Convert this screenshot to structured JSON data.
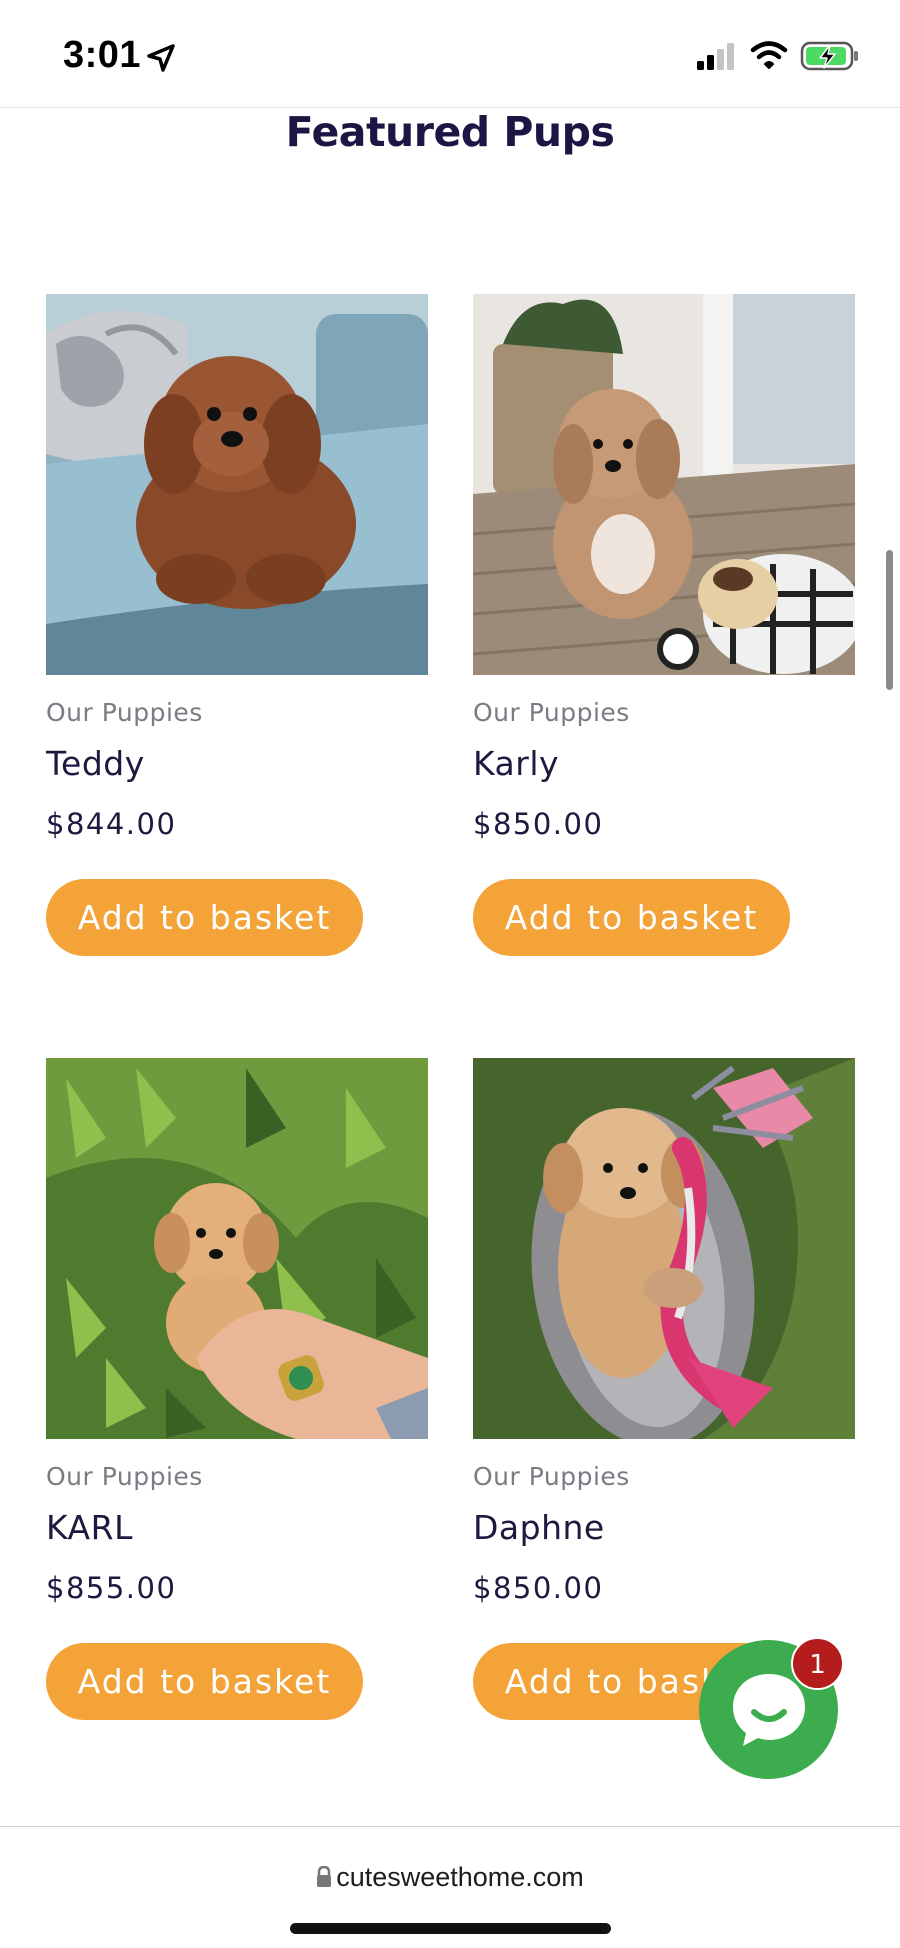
{
  "status_bar": {
    "time": "3:01",
    "battery_color": "#4cd964"
  },
  "section": {
    "title": "Featured Pups"
  },
  "products": [
    {
      "category": "Our Puppies",
      "name": "Teddy",
      "price": "$844.00",
      "button_label": "Add to basket"
    },
    {
      "category": "Our Puppies",
      "name": "Karly",
      "price": "$850.00",
      "button_label": "Add to basket"
    },
    {
      "category": "Our Puppies",
      "name": "KARL",
      "price": "$855.00",
      "button_label": "Add to basket"
    },
    {
      "category": "Our Puppies",
      "name": "Daphne",
      "price": "$850.00",
      "button_label": "Add to basket"
    }
  ],
  "chat": {
    "badge_count": "1",
    "color": "#3cac4e"
  },
  "browser": {
    "url": "cutesweethome.com"
  },
  "colors": {
    "accent": "#f3a337",
    "heading": "#1f1545"
  }
}
